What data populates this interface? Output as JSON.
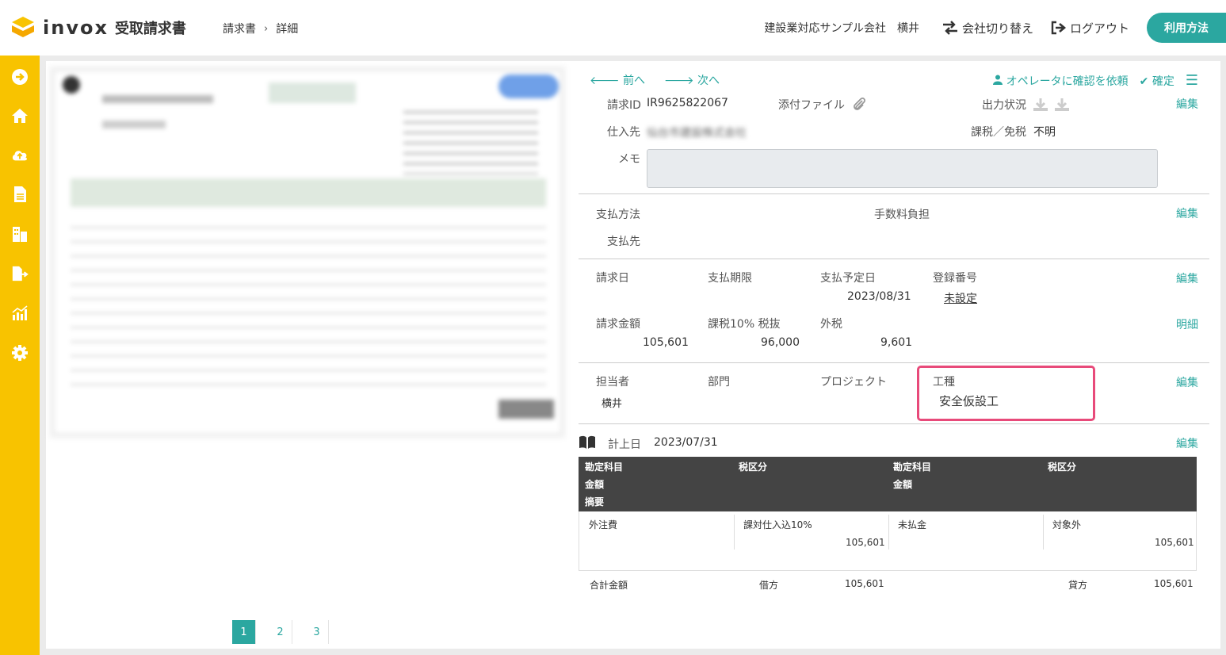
{
  "header": {
    "logo_text": "invox",
    "logo_sub": "受取請求書",
    "breadcrumb": [
      "請求書",
      "詳細"
    ],
    "breadcrumb_sep": "›",
    "company": "建設業対応サンプル会社　横井",
    "switch_company": "会社切り替え",
    "logout": "ログアウト",
    "help": "利用方法",
    "brand_color": "#f8c300",
    "accent_color": "#2ba7a0"
  },
  "sidebar": {
    "items": [
      {
        "icon": "arrow-right-circle-icon"
      },
      {
        "icon": "home-icon"
      },
      {
        "icon": "cloud-upload-icon"
      },
      {
        "icon": "document-icon"
      },
      {
        "icon": "building-icon"
      },
      {
        "icon": "document-export-icon"
      },
      {
        "icon": "chart-icon"
      },
      {
        "icon": "gear-icon"
      }
    ]
  },
  "pager": {
    "pages": [
      "1",
      "2",
      "3"
    ],
    "current": "1"
  },
  "detail": {
    "prev": "前へ",
    "next": "次へ",
    "ask_operator": "オペレータに確認を依頼",
    "confirm": "確定",
    "edit": "編集",
    "detail_link": "明細",
    "invoice_id_label": "請求ID",
    "invoice_id": "IR9625822067",
    "attachment_label": "添付ファイル",
    "output_status_label": "出力状況",
    "supplier_label": "仕入先",
    "supplier_value": "仙台市建設株式会社",
    "tax_label": "課税／免税",
    "tax_value": "不明",
    "memo_label": "メモ",
    "payment_method_label": "支払方法",
    "fee_label": "手数料負担",
    "payee_label": "支払先",
    "invoice_date_label": "請求日",
    "due_date_label": "支払期限",
    "scheduled_date_label": "支払予定日",
    "scheduled_date": "2023/08/31",
    "reg_no_label": "登録番号",
    "reg_no_value": "未設定",
    "amount_label": "請求金額",
    "amount": "105,601",
    "tax10_label": "課税10% 税抜",
    "tax10": "96,000",
    "ext_tax_label": "外税",
    "ext_tax": "9,601",
    "staff_label": "担当者",
    "staff": "横井",
    "dept_label": "部門",
    "project_label": "プロジェクト",
    "work_type_label": "工種",
    "work_type": "安全仮設工",
    "posting_label": "計上日",
    "posting_date": "2023/07/31"
  },
  "journal": {
    "headers": {
      "debit_account": "勘定科目",
      "debit_tax": "税区分",
      "credit_account": "勘定科目",
      "credit_tax": "税区分",
      "debit_amount": "金額",
      "credit_amount": "金額",
      "memo": "摘要"
    },
    "row": {
      "debit_account": "外注費",
      "debit_tax": "課対仕入込10%",
      "debit_amount": "105,601",
      "credit_account": "未払金",
      "credit_tax": "対象外",
      "credit_amount": "105,601"
    },
    "footer": {
      "total_label": "合計金額",
      "debit_label": "借方",
      "debit_total": "105,601",
      "credit_label": "貸方",
      "credit_total": "105,601"
    }
  }
}
